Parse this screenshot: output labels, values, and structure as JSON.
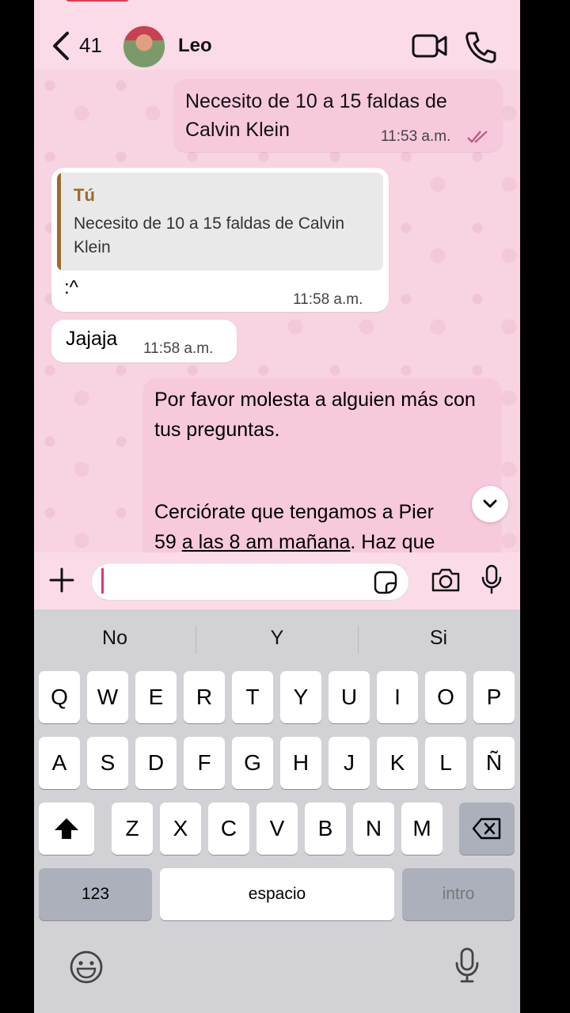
{
  "header": {
    "back_count": "41",
    "contact_name": "Leo"
  },
  "messages": [
    {
      "direction": "out",
      "text": "Necesito de 10 a 15 faldas de Calvin Klein",
      "time": "11:53 a.m.",
      "status": "read"
    },
    {
      "direction": "in",
      "quote_author": "Tú",
      "quote_text": "Necesito de 10 a 15 faldas de Calvin Klein",
      "text": ":^",
      "time": "11:58 a.m."
    },
    {
      "direction": "in",
      "text": "Jajaja",
      "time": "11:58 a.m."
    },
    {
      "direction": "out",
      "paragraph1": "Por favor molesta a alguien más con tus preguntas.",
      "paragraph2_line1_a": "Cerciórate que tengamos a Pier",
      "paragraph2_line2_a": "59 ",
      "paragraph2_line2_link": "a las 8 am mañana",
      "paragraph2_line2_b": ". Haz que"
    }
  ],
  "composer": {
    "input_value": ""
  },
  "keyboard": {
    "suggestions": [
      "No",
      "Y",
      "Si"
    ],
    "row1": [
      "Q",
      "W",
      "E",
      "R",
      "T",
      "Y",
      "U",
      "I",
      "O",
      "P"
    ],
    "row2": [
      "A",
      "S",
      "D",
      "F",
      "G",
      "H",
      "J",
      "K",
      "L",
      "Ñ"
    ],
    "row3": [
      "Z",
      "X",
      "C",
      "V",
      "B",
      "N",
      "M"
    ],
    "numbers_label": "123",
    "space_label": "espacio",
    "return_label": "intro"
  },
  "colors": {
    "background": "#fbdbe8",
    "outgoing_bubble": "#f7c9dc",
    "incoming_bubble": "#ffffff",
    "quote_accent": "#9a6b2e",
    "read_ticks": "#c0527e"
  }
}
